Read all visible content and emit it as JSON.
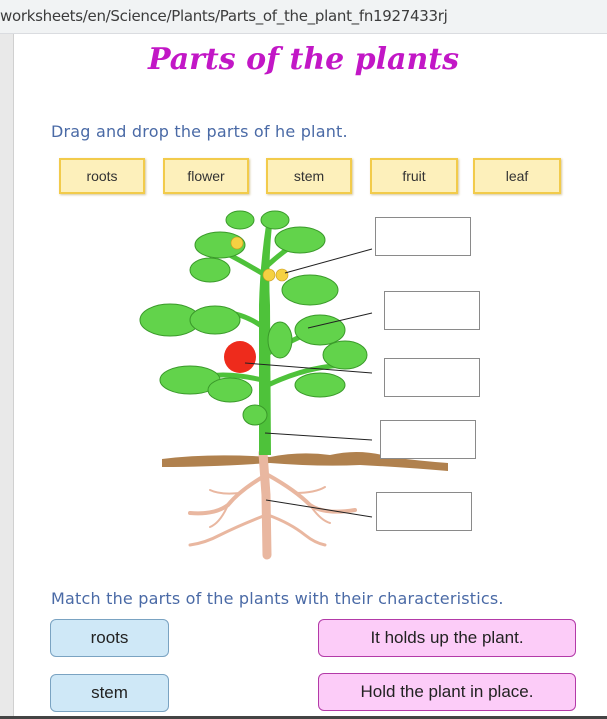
{
  "browser": {
    "url": "worksheets/en/Science/Plants/Parts_of_the_plant_fn1927433rj"
  },
  "worksheet": {
    "title": "Parts of the plants",
    "section1": {
      "instruction": "Drag and drop the parts of he plant.",
      "word_bank": [
        "roots",
        "flower",
        "stem",
        "fruit",
        "leaf"
      ],
      "drop_zones": [
        "",
        "",
        "",
        "",
        ""
      ],
      "diagram": "tomato-plant-diagram"
    },
    "section2": {
      "instruction": "Match the parts of the plants with their characteristics.",
      "left_items": [
        "roots",
        "stem"
      ],
      "right_items": [
        "It holds up the plant.",
        "Hold the plant in place."
      ]
    }
  },
  "colors": {
    "title": "#c217c6",
    "instruction": "#4a6aa6",
    "chip_bg": "#fdf0bb",
    "chip_border": "#f2cb4b",
    "match_left_bg": "#cfe8f7",
    "match_right_bg": "#fcccf8"
  }
}
